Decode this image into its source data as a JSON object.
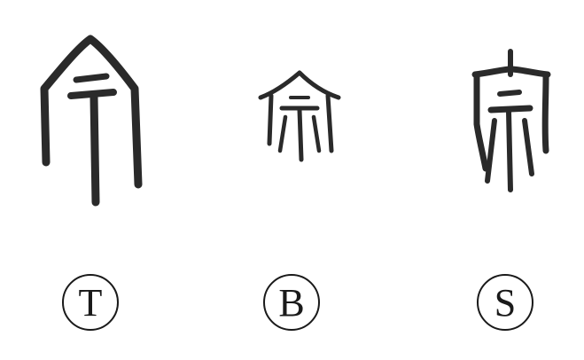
{
  "figure": {
    "glyph_color": "#2a2a2a",
    "labels": [
      {
        "letter": "T",
        "glyph": "ancient-glyph-tall-roof-single-stem"
      },
      {
        "letter": "B",
        "glyph": "ancient-glyph-small-roof-with-strokes"
      },
      {
        "letter": "S",
        "glyph": "ancient-glyph-spired-roof-with-legs"
      }
    ]
  }
}
